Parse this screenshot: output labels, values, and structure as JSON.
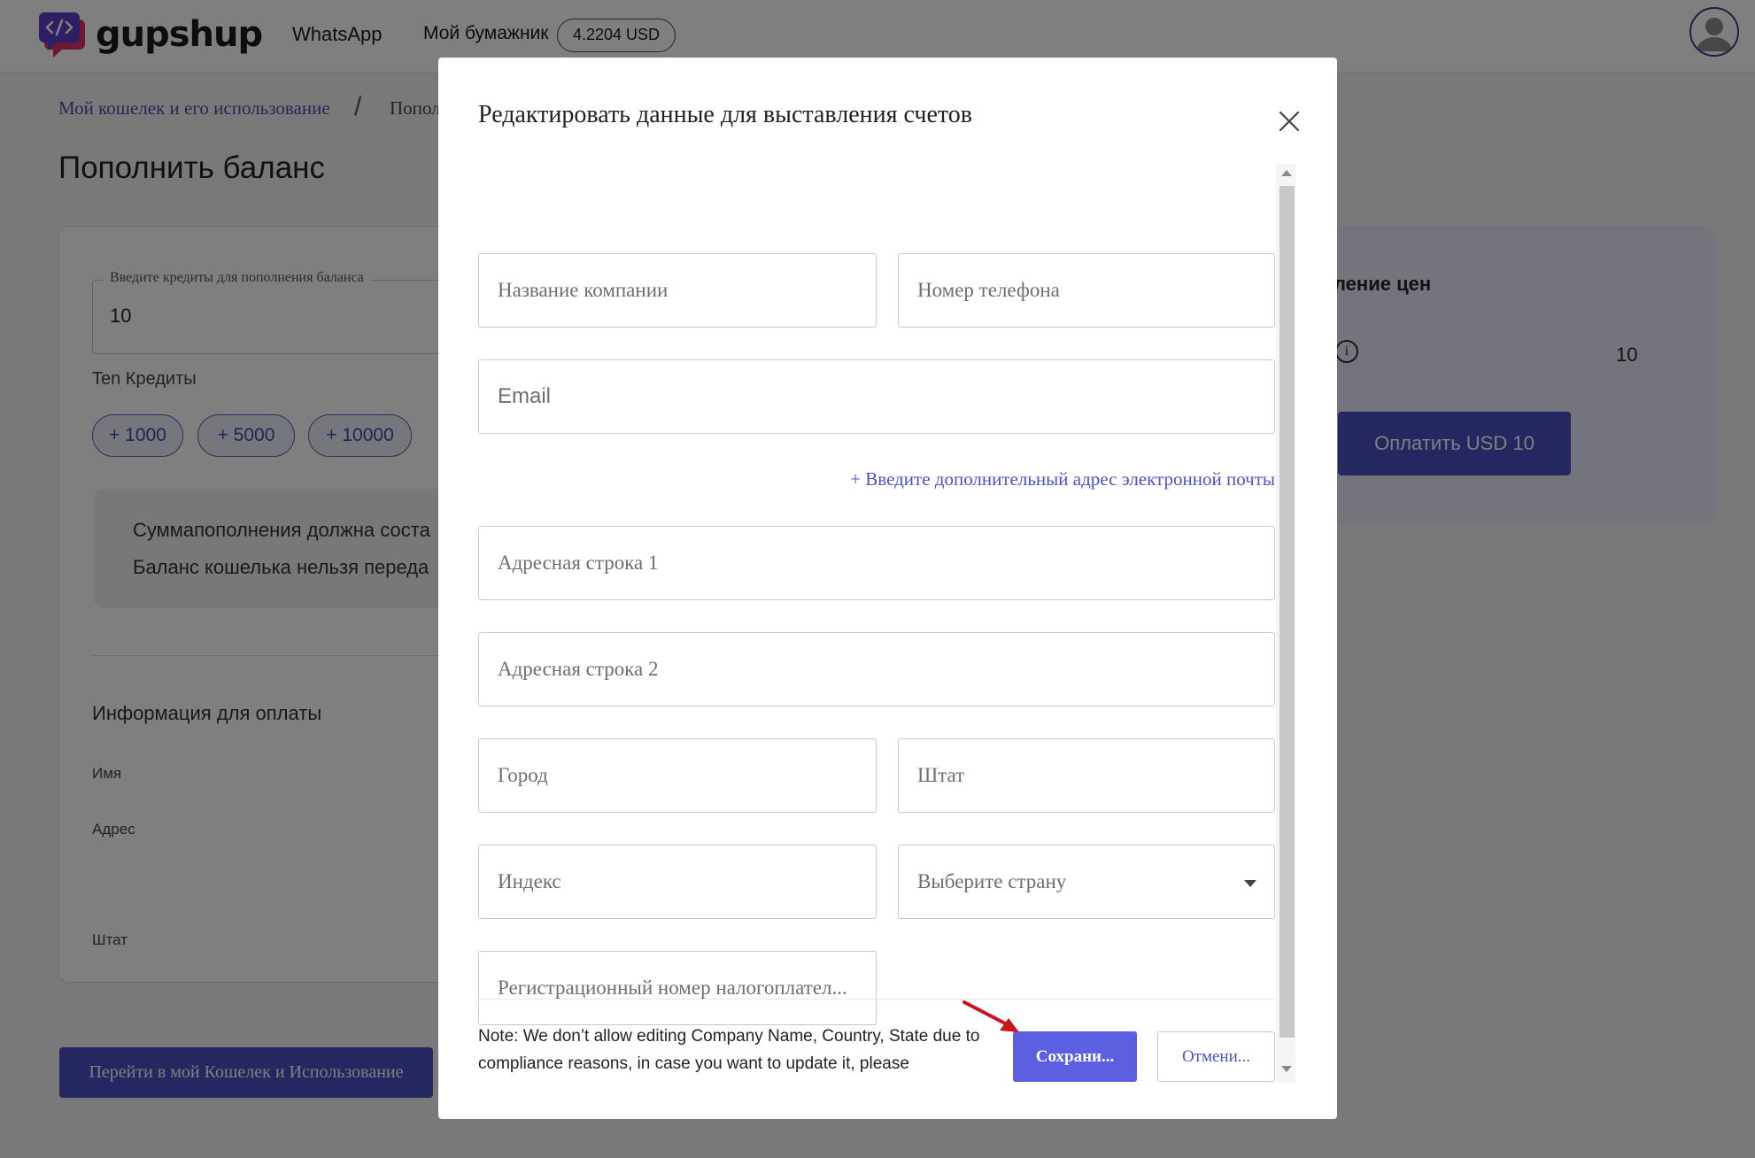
{
  "nav": {
    "brand": "gupshup",
    "whatsapp": "WhatsApp",
    "wallet_label": "Мой бумажник",
    "wallet_balance": "4.2204 USD"
  },
  "page": {
    "breadcrumb_1": "Мой кошелек и его использование",
    "breadcrumb_sep": "/",
    "breadcrumb_2": "Попол",
    "title": "Пополнить баланс",
    "credit_label": "Введите кредиты для пополнения баланса",
    "credit_value": "10",
    "credit_words": "Ten Кредиты",
    "chips": [
      "+ 1000",
      "+ 5000",
      "+ 10000"
    ],
    "note_line1": "Суммапополнения должна соста",
    "note_line2": "Баланс кошелька нельзя переда",
    "pay_info_title": "Информация для оплаты",
    "label_name": "Имя",
    "label_address": "Адрес",
    "label_state": "Штат",
    "wallet_button": "Перейти в мой Кошелек и Использование",
    "price_title": "ление цен",
    "price_value": "10",
    "pay_button": "Оплатить USD 10"
  },
  "modal": {
    "title": "Редактировать данные для выставления счетов",
    "company_placeholder": "Название компании",
    "phone_placeholder": "Номер телефона",
    "email_placeholder": "Email",
    "add_email_link": "+ Введите дополнительный адрес электронной почты",
    "address1_placeholder": "Адресная строка 1",
    "address2_placeholder": "Адресная строка 2",
    "city_placeholder": "Город",
    "state_placeholder": "Штат",
    "zip_placeholder": "Индекс",
    "country_placeholder": "Выберите страну",
    "tax_placeholder": "Регистрационный номер налогоплател...",
    "footer_note": "Note: We don’t allow editing Company Name, Country, State due to compliance reasons, in case you want to update it, please",
    "save_button": "Сохрани...",
    "cancel_button": "Отмени..."
  },
  "colors": {
    "accent": "#4a4fc2",
    "button_primary": "#5b5fe0",
    "link": "#4c51c6",
    "annotation_arrow": "#c8141c"
  }
}
